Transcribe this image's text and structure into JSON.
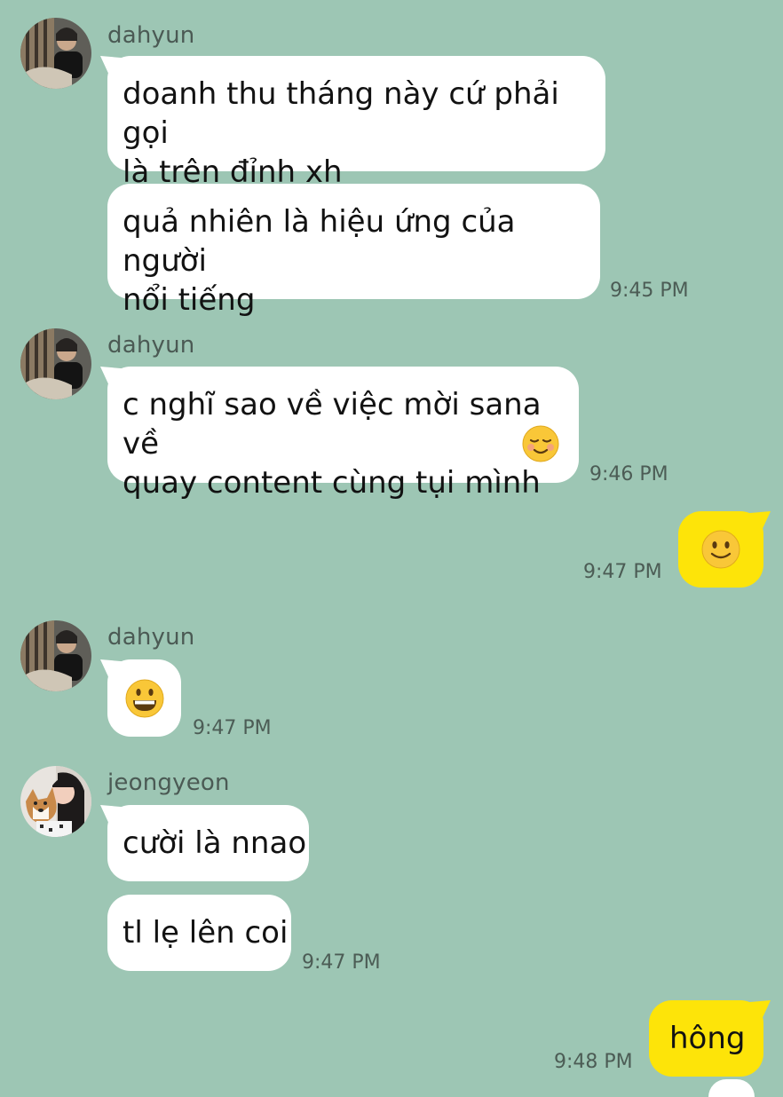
{
  "chat": {
    "groups": [
      {
        "sender": "dahyun",
        "messages": [
          "doanh thu tháng này cứ phải gọi\nlà trên đỉnh xh",
          "quả nhiên là hiệu ứng của người\nnổi tiếng"
        ],
        "time": "9:45 PM"
      },
      {
        "sender": "dahyun",
        "messages": [
          "c nghĩ sao về việc mời sana về\nquay content cùng tụi mình"
        ],
        "emoji": "relieved-smile-emoji",
        "time": "9:46 PM"
      },
      {
        "sender": "me",
        "emoji": "slight-smile-emoji",
        "time": "9:47 PM"
      },
      {
        "sender": "dahyun",
        "emoji": "grin-emoji",
        "time": "9:47 PM"
      },
      {
        "sender": "jeongyeon",
        "messages": [
          "cười là nnao",
          "tl lẹ lên coi"
        ],
        "time": "9:47 PM"
      },
      {
        "sender": "me",
        "messages": [
          "hông"
        ],
        "time": "9:48 PM"
      }
    ]
  },
  "colors": {
    "background": "#9dc6b4",
    "incoming_bubble": "#ffffff",
    "outgoing_bubble": "#fde409",
    "emoji": "#f9c738"
  }
}
